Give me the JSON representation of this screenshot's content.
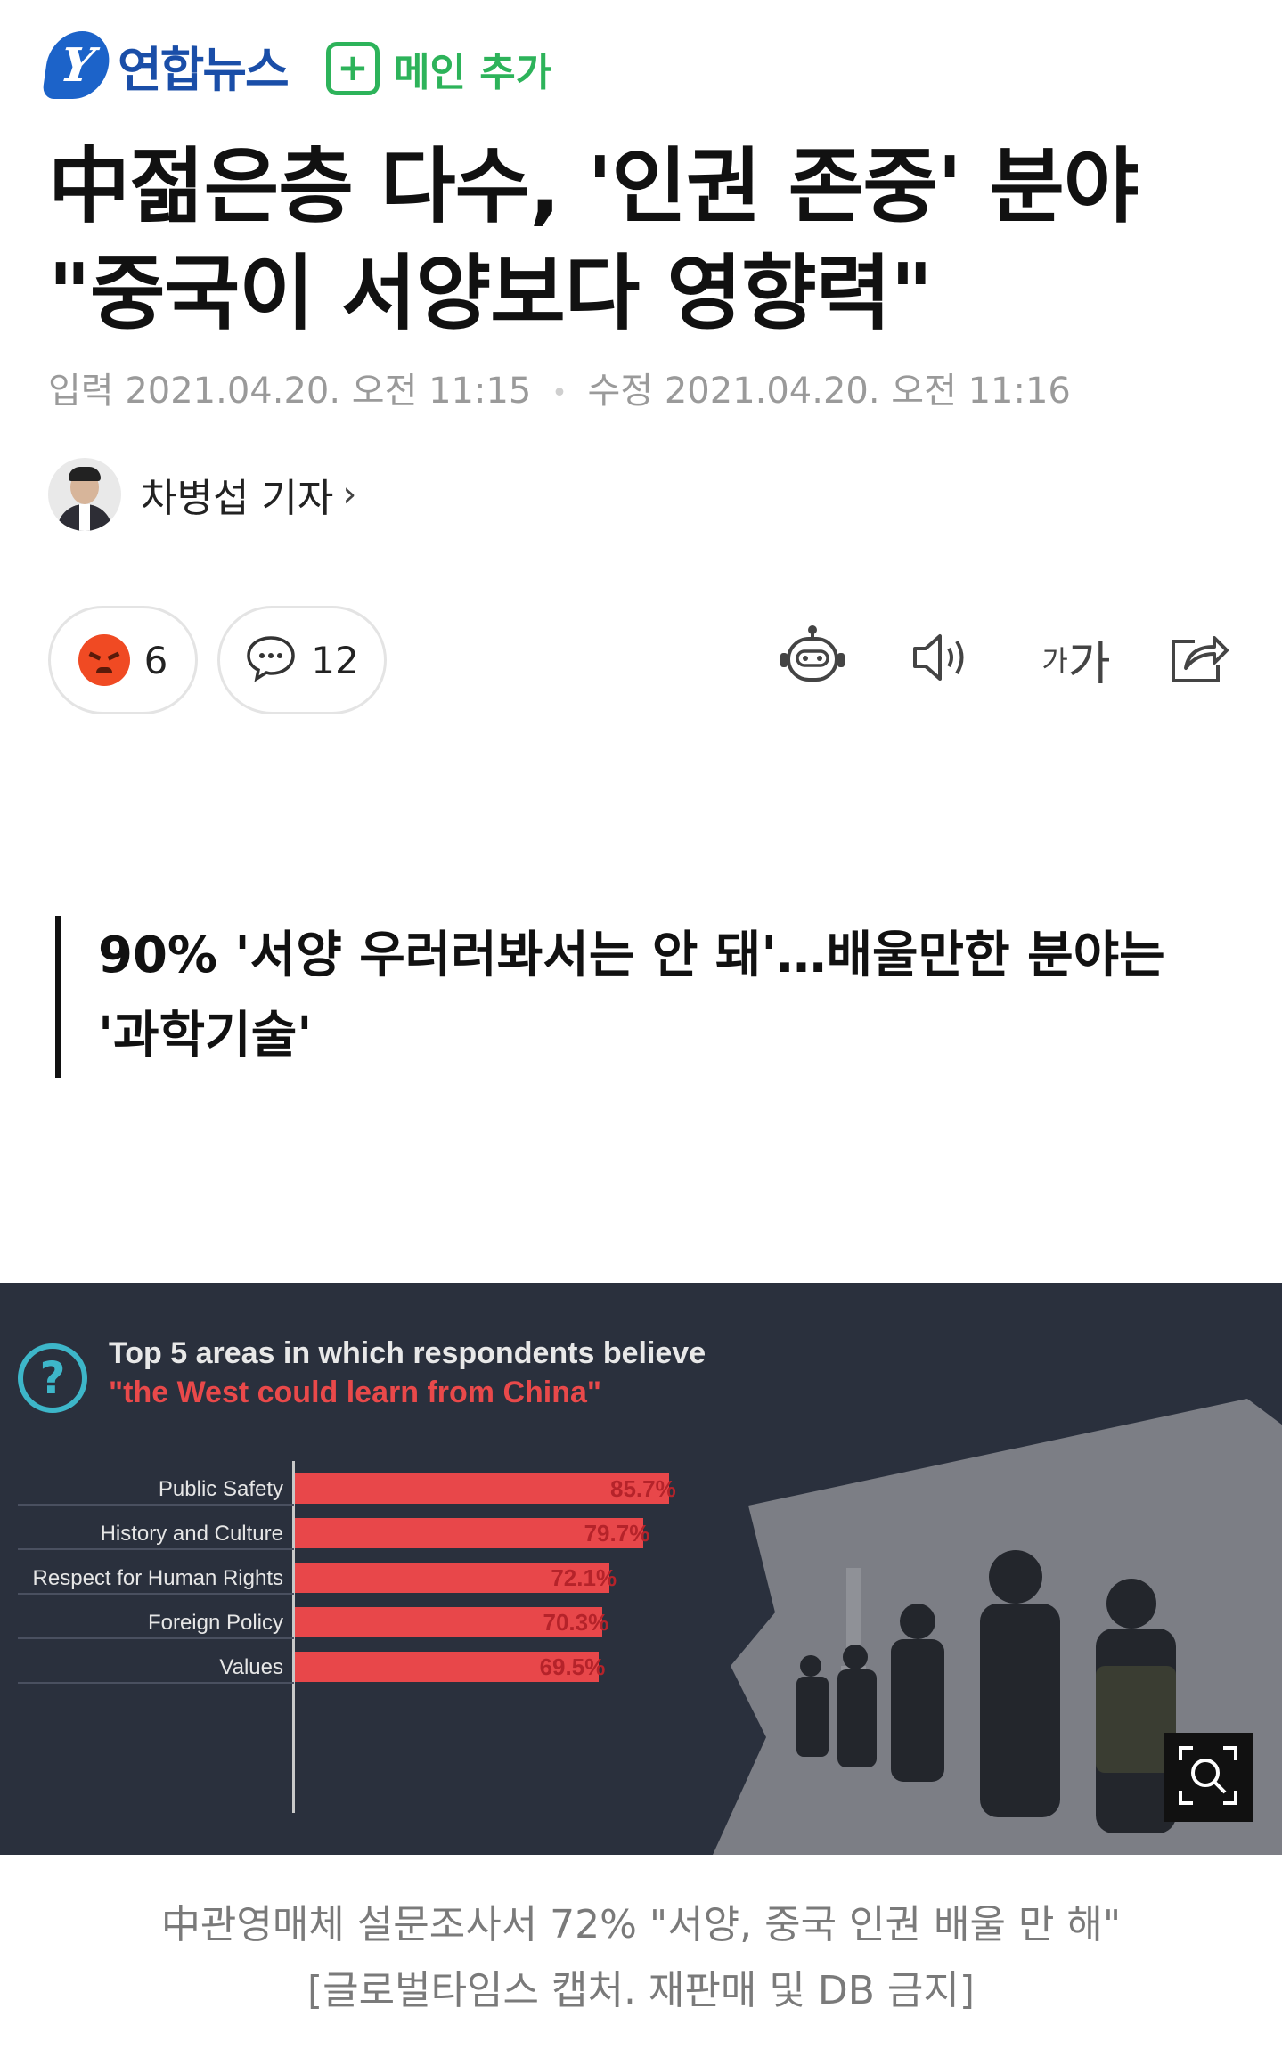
{
  "header": {
    "logo_text": "연합뉴스",
    "logo_glyph": "Y",
    "add_main_symbol": "+",
    "add_main_label": "메인 추가"
  },
  "article": {
    "title": "中젊은층 다수, '인권 존중' 분야 \"중국이 서양보다 영향력\"",
    "input_label": "입력",
    "input_date": "2021.04.20. 오전 11:15",
    "separator": "•",
    "edit_label": "수정",
    "edit_date": "2021.04.20. 오전 11:16",
    "author": "차병섭 기자",
    "author_chevron": "›",
    "reaction_count": "6",
    "comment_count": "12",
    "font_size_small": "가",
    "font_size_large": "가",
    "subheading": "90% '서양 우러러봐서는 안 돼'…배울만한 분야는 '과학기술'",
    "caption_line1": "中관영매체 설문조사서 72% \"서양, 중국 인권 배울 만 해\"",
    "caption_line2": "[글로벌타임스 캡처. 재판매 및 DB 금지]"
  },
  "icons": {
    "reaction": "angry-face-icon",
    "comment": "speech-bubble-icon",
    "robot": "robot-icon",
    "speaker": "speaker-icon",
    "share": "share-icon",
    "zoom": "zoom-icon"
  },
  "colors": {
    "brand_blue": "#1c63c9",
    "add_green": "#2db35a",
    "bar_red": "#e8474a",
    "figure_bg": "#2a303d"
  },
  "chart_data": {
    "type": "bar",
    "orientation": "horizontal",
    "title": "Top 5 areas in which respondents believe",
    "subtitle": "\"the West could learn from China\"",
    "categories": [
      "Public Safety",
      "History and Culture",
      "Respect for Human Rights",
      "Foreign Policy",
      "Values"
    ],
    "values": [
      85.7,
      79.7,
      72.1,
      70.3,
      69.5
    ],
    "value_labels": [
      "85.7%",
      "79.7%",
      "72.1%",
      "70.3%",
      "69.5%"
    ],
    "xlim": [
      0,
      100
    ],
    "grid": false
  }
}
